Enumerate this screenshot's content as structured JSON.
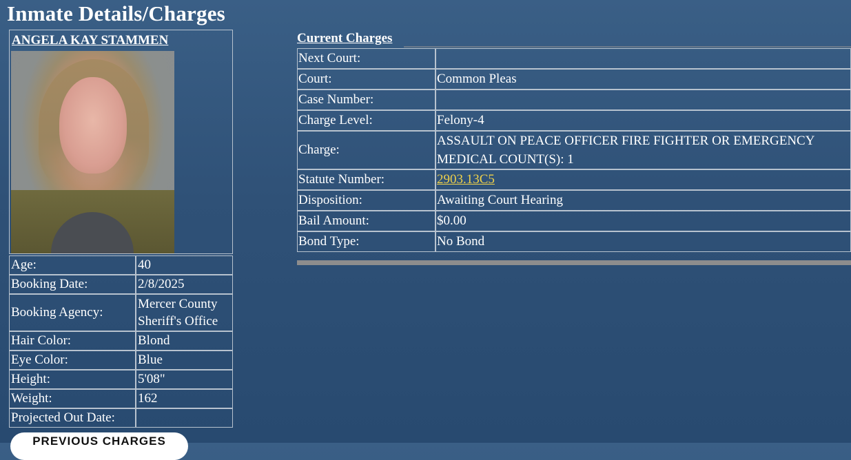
{
  "page_title": "Inmate Details/Charges",
  "inmate": {
    "name": "ANGELA KAY STAMMEN",
    "details": [
      {
        "label": "Age:",
        "value": "40"
      },
      {
        "label": "Booking Date:",
        "value": "2/8/2025"
      },
      {
        "label": "Booking Agency:",
        "value": "Mercer County Sheriff's Office"
      },
      {
        "label": "Hair Color:",
        "value": "Blond"
      },
      {
        "label": "Eye Color:",
        "value": "Blue"
      },
      {
        "label": "Height:",
        "value": "5'08\""
      },
      {
        "label": "Weight:",
        "value": "162"
      },
      {
        "label": "Projected Out Date:",
        "value": ""
      }
    ]
  },
  "previous_charges_button": "PREVIOUS CHARGES",
  "charges": {
    "heading": "Current Charges",
    "rows": [
      {
        "label": "Next Court:",
        "value": ""
      },
      {
        "label": "Court:",
        "value": "Common Pleas"
      },
      {
        "label": "Case Number:",
        "value": ""
      },
      {
        "label": "Charge Level:",
        "value": "Felony-4"
      },
      {
        "label": "Charge:",
        "value": "ASSAULT ON PEACE OFFICER FIRE FIGHTER OR EMERGENCY MEDICAL  COUNT(S): 1"
      },
      {
        "label": "Statute Number:",
        "value": "2903.13C5"
      },
      {
        "label": "Disposition:",
        "value": "Awaiting Court Hearing"
      },
      {
        "label": "Bail Amount:",
        "value": "$0.00"
      },
      {
        "label": "Bond Type:",
        "value": "No Bond"
      }
    ]
  },
  "colors": {
    "background": "#2f5177",
    "link": "#f0d24a",
    "border": "#b8c3cf"
  }
}
